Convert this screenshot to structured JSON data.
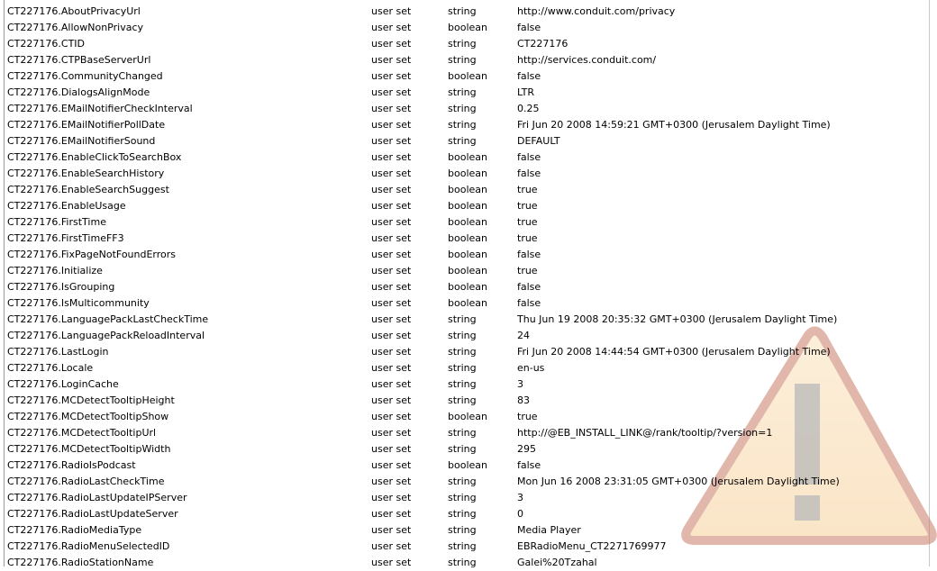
{
  "preferences": [
    {
      "name": "CT227176.AboutPrivacyUrl",
      "status": "user set",
      "type": "string",
      "value": "http://www.conduit.com/privacy"
    },
    {
      "name": "CT227176.AllowNonPrivacy",
      "status": "user set",
      "type": "boolean",
      "value": "false"
    },
    {
      "name": "CT227176.CTID",
      "status": "user set",
      "type": "string",
      "value": "CT227176"
    },
    {
      "name": "CT227176.CTPBaseServerUrl",
      "status": "user set",
      "type": "string",
      "value": "http://services.conduit.com/"
    },
    {
      "name": "CT227176.CommunityChanged",
      "status": "user set",
      "type": "boolean",
      "value": "false"
    },
    {
      "name": "CT227176.DialogsAlignMode",
      "status": "user set",
      "type": "string",
      "value": "LTR"
    },
    {
      "name": "CT227176.EMailNotifierCheckInterval",
      "status": "user set",
      "type": "string",
      "value": "0.25"
    },
    {
      "name": "CT227176.EMailNotifierPollDate",
      "status": "user set",
      "type": "string",
      "value": "Fri Jun 20 2008 14:59:21 GMT+0300 (Jerusalem Daylight Time)"
    },
    {
      "name": "CT227176.EMailNotifierSound",
      "status": "user set",
      "type": "string",
      "value": "DEFAULT"
    },
    {
      "name": "CT227176.EnableClickToSearchBox",
      "status": "user set",
      "type": "boolean",
      "value": "false"
    },
    {
      "name": "CT227176.EnableSearchHistory",
      "status": "user set",
      "type": "boolean",
      "value": "false"
    },
    {
      "name": "CT227176.EnableSearchSuggest",
      "status": "user set",
      "type": "boolean",
      "value": "true"
    },
    {
      "name": "CT227176.EnableUsage",
      "status": "user set",
      "type": "boolean",
      "value": "true"
    },
    {
      "name": "CT227176.FirstTime",
      "status": "user set",
      "type": "boolean",
      "value": "true"
    },
    {
      "name": "CT227176.FirstTimeFF3",
      "status": "user set",
      "type": "boolean",
      "value": "true"
    },
    {
      "name": "CT227176.FixPageNotFoundErrors",
      "status": "user set",
      "type": "boolean",
      "value": "false"
    },
    {
      "name": "CT227176.Initialize",
      "status": "user set",
      "type": "boolean",
      "value": "true"
    },
    {
      "name": "CT227176.IsGrouping",
      "status": "user set",
      "type": "boolean",
      "value": "false"
    },
    {
      "name": "CT227176.IsMulticommunity",
      "status": "user set",
      "type": "boolean",
      "value": "false"
    },
    {
      "name": "CT227176.LanguagePackLastCheckTime",
      "status": "user set",
      "type": "string",
      "value": "Thu Jun 19 2008 20:35:32 GMT+0300 (Jerusalem Daylight Time)"
    },
    {
      "name": "CT227176.LanguagePackReloadInterval",
      "status": "user set",
      "type": "string",
      "value": "24"
    },
    {
      "name": "CT227176.LastLogin",
      "status": "user set",
      "type": "string",
      "value": "Fri Jun 20 2008 14:44:54 GMT+0300 (Jerusalem Daylight Time)"
    },
    {
      "name": "CT227176.Locale",
      "status": "user set",
      "type": "string",
      "value": "en-us"
    },
    {
      "name": "CT227176.LoginCache",
      "status": "user set",
      "type": "string",
      "value": "3"
    },
    {
      "name": "CT227176.MCDetectTooltipHeight",
      "status": "user set",
      "type": "string",
      "value": "83"
    },
    {
      "name": "CT227176.MCDetectTooltipShow",
      "status": "user set",
      "type": "boolean",
      "value": "true"
    },
    {
      "name": "CT227176.MCDetectTooltipUrl",
      "status": "user set",
      "type": "string",
      "value": "http://@EB_INSTALL_LINK@/rank/tooltip/?version=1"
    },
    {
      "name": "CT227176.MCDetectTooltipWidth",
      "status": "user set",
      "type": "string",
      "value": "295"
    },
    {
      "name": "CT227176.RadioIsPodcast",
      "status": "user set",
      "type": "boolean",
      "value": "false"
    },
    {
      "name": "CT227176.RadioLastCheckTime",
      "status": "user set",
      "type": "string",
      "value": "Mon Jun 16 2008 23:31:05 GMT+0300 (Jerusalem Daylight Time)"
    },
    {
      "name": "CT227176.RadioLastUpdateIPServer",
      "status": "user set",
      "type": "string",
      "value": "3"
    },
    {
      "name": "CT227176.RadioLastUpdateServer",
      "status": "user set",
      "type": "string",
      "value": "0"
    },
    {
      "name": "CT227176.RadioMediaType",
      "status": "user set",
      "type": "string",
      "value": "Media Player"
    },
    {
      "name": "CT227176.RadioMenuSelectedID",
      "status": "user set",
      "type": "string",
      "value": "EBRadioMenu_CT2271769977"
    },
    {
      "name": "CT227176.RadioStationName",
      "status": "user set",
      "type": "string",
      "value": "Galei%20Tzahal"
    }
  ],
  "colors": {
    "watermark_fill": "#f9d9a8",
    "watermark_border": "#c97b67",
    "watermark_mark": "#b8b8b8"
  },
  "icons": {
    "watermark": "warning-triangle-icon"
  }
}
